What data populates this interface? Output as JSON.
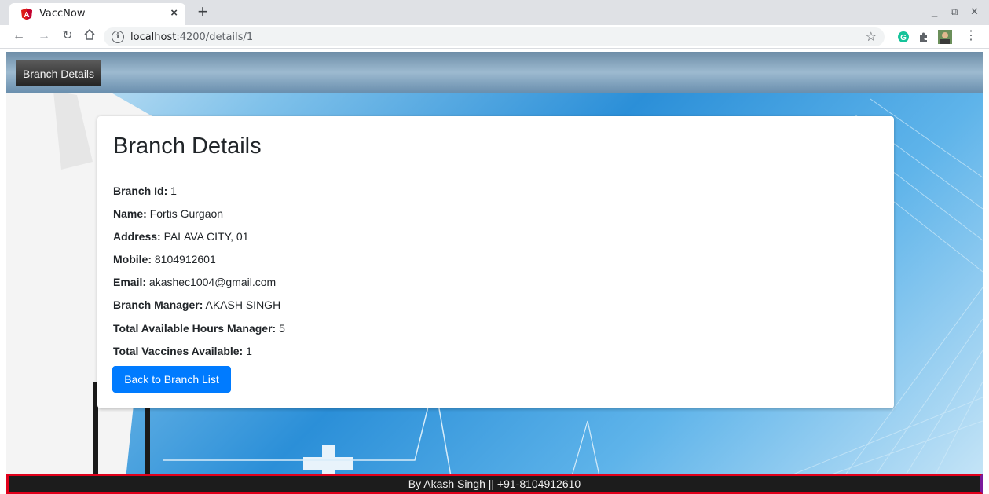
{
  "browser": {
    "tab_title": "VaccNow",
    "tab_close": "×",
    "new_tab": "+",
    "url_host": "localhost",
    "url_path": ":4200/details/1",
    "controls": {
      "minimize": "_",
      "restore": "⧉",
      "close": "✕"
    }
  },
  "navbar": {
    "brand": "Branch Details"
  },
  "card": {
    "title": "Branch Details",
    "details": [
      {
        "label": "Branch Id:",
        "value": "1"
      },
      {
        "label": "Name:",
        "value": "Fortis Gurgaon"
      },
      {
        "label": "Address:",
        "value": "PALAVA CITY, 01"
      },
      {
        "label": "Mobile:",
        "value": "8104912601"
      },
      {
        "label": "Email:",
        "value": "akashec1004@gmail.com"
      },
      {
        "label": "Branch Manager:",
        "value": "AKASH SINGH"
      },
      {
        "label": "Total Available Hours Manager:",
        "value": "5"
      },
      {
        "label": "Total Vaccines Available:",
        "value": "1"
      }
    ],
    "back_button": "Back to Branch List"
  },
  "footer": {
    "text": "By Akash Singh || +91-8104912610"
  },
  "colors": {
    "primary": "#007bff",
    "footer_bg": "#1c1c1c",
    "footer_border": "#e1001b"
  },
  "icons": [
    "angular-favicon-icon",
    "back-arrow-icon",
    "forward-arrow-icon",
    "reload-icon",
    "home-icon",
    "info-icon",
    "star-icon",
    "grammarly-icon",
    "extensions-icon",
    "profile-avatar-icon",
    "menu-dots-icon"
  ]
}
